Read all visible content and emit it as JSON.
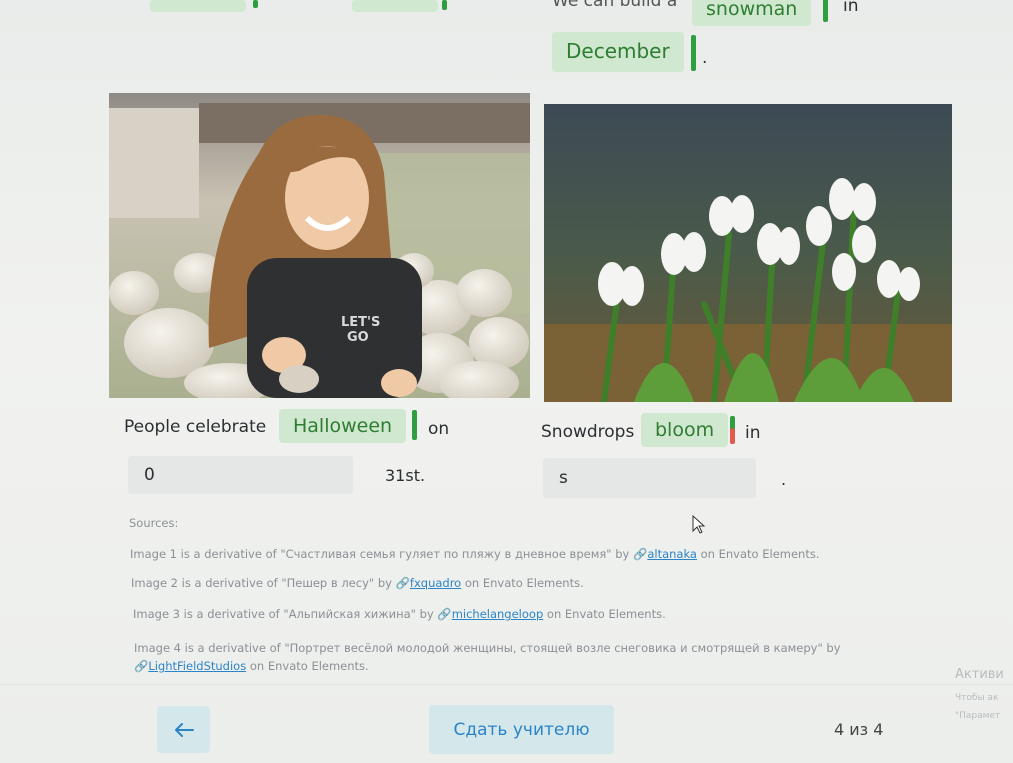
{
  "top_row": {
    "sentence_before": "We can build a",
    "word_snowman": "snowman",
    "after_snowman": "in",
    "word_december": "December",
    "period": "."
  },
  "card_halloween": {
    "image_name": "girl-with-white-pumpkins",
    "text_before": "People celebrate",
    "word": "Halloween",
    "text_after": "on",
    "input_value": "0",
    "after_input": "31st."
  },
  "card_snowdrops": {
    "image_name": "snowdrops-flowers",
    "text_before": "Snowdrops",
    "word": "bloom",
    "text_after": "in",
    "input_value": "s",
    "after_input": "."
  },
  "sources": {
    "heading": "Sources:",
    "items": [
      {
        "prefix": "Image 1 is a derivative of \"Счастливая семья гуляет по пляжу в дневное время\" by",
        "author": "altanaka",
        "suffix": "on Envato Elements."
      },
      {
        "prefix": "Image 2 is a derivative of \"Пешер в лесу\" by",
        "author": "fxquadro",
        "suffix": "on Envato Elements."
      },
      {
        "prefix": "Image 3 is a derivative of \"Альпийская хижина\" by",
        "author": "michelangeloop",
        "suffix": "on Envato Elements."
      },
      {
        "prefix": "Image 4 is a derivative of \"Портрет весёлой молодой женщины, стоящей возле снеговика и смотрящей в камеру\" by",
        "author": "LightFieldStudios",
        "suffix": "on Envato Elements."
      }
    ]
  },
  "footer": {
    "back_icon": "arrow-left-icon",
    "submit_label": "Сдать учителю",
    "page_counter": "4 из 4"
  },
  "watermark": {
    "line1": "Активи",
    "line2": "Чтобы ак",
    "line3": "\"Парамет"
  },
  "colors": {
    "word_bg": "#cfe8cf",
    "word_text": "#2e7d32",
    "bar_green": "#2e9e3f",
    "bar_red": "#e05a4e",
    "link": "#2c84c8",
    "button_bg": "#d4e8ec"
  }
}
